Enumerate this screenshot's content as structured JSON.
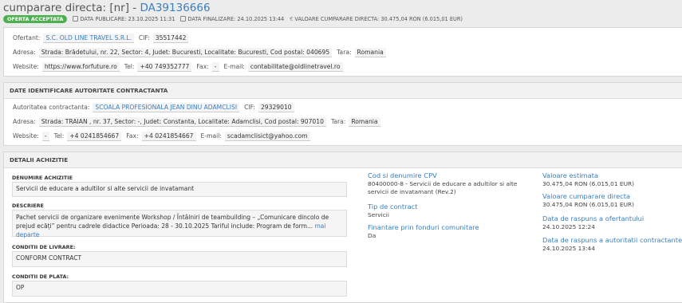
{
  "header": {
    "title_prefix": "cumparare directa: [nr] - ",
    "code": "DA39136666",
    "status": "OFERTA ACCEPTATA",
    "publish": "DATA PUBLICARE: 23.10.2025 11:31",
    "finalize": "DATA FINALIZARE: 24.10.2025 13:44",
    "value": "VALOARE CUMPARARE DIRECTA: 30.475,04   RON (6.015,01  EUR)"
  },
  "offerer": {
    "ofertant_label": "Ofertant:",
    "ofertant": "S.C. OLD LINE TRAVEL S.R.L.",
    "cif_label": "CIF:",
    "cif": "35517442",
    "adresa_label": "Adresa:",
    "adresa": "Strada: Brădetului, nr. 22, Sector: 4, Judet: Bucuresti, Localitate: Bucuresti, Cod postal: 040695",
    "tara_label": "Tara:",
    "tara": "Romania",
    "website_label": "Website:",
    "website": "https://www.forfuture.ro",
    "tel_label": "Tel:",
    "tel": "+40 749352777",
    "fax_label": "Fax:",
    "fax": "-",
    "email_label": "E-mail:",
    "email": "contabilitate@oldlinetravel.ro"
  },
  "authority": {
    "section_title": "DATE IDENTIFICARE AUTORITATE CONTRACTANTA",
    "name_label": "Autoritatea contractanta:",
    "name": "SCOALA PROFESIONALA JEAN DINU ADAMCLISI",
    "cif_label": "CIF:",
    "cif": "29329010",
    "adresa_label": "Adresa:",
    "adresa": "Strada: TRAIAN , nr. 37, Sector: -, Judet: Constanta, Localitate: Adamclisi, Cod postal: 907010",
    "tara_label": "Tara:",
    "tara": "Romania",
    "website_label": "Website:",
    "website": "-",
    "tel_label": "Tel:",
    "tel": "+4 0241854667",
    "fax_label": "Fax:",
    "fax": "+4 0241854667",
    "email_label": "E-mail:",
    "email": "scadamclisict@yahoo.com"
  },
  "details": {
    "section_title": "DETALII ACHIZITIE",
    "denumire_label": "DENUMIRE ACHIZITIE",
    "denumire": "Servicii de educare a adultilor si alte servicii de invatamant",
    "descriere_label": "DESCRIERE",
    "descriere": "Pachet servicii de organizare evenimente Workshop / Întâlniri de teambuilding – „Comunicare dincolo de prejud ecăți” pentru cadrele didactice Perioada: 28 - 30.10.2025 Tariful include: Program de form...",
    "mai_departe": "mai departe",
    "livrare_label": "CONDITII DE LIVRARE:",
    "livrare": "CONFORM CONTRACT",
    "plata_label": "CONDITII DE PLATA:",
    "plata": "OP",
    "cpv_title": "Cod si denumire CPV",
    "cpv_value": "80400000-8 - Servicii de educare a adultilor si alte servicii de invatamant (Rev.2)",
    "tip_title": "Tip de contract",
    "tip_value": "Servicii",
    "fonduri_title": "Finantare prin fonduri comunitare",
    "fonduri_value": "Da",
    "estimata_title": "Valoare estimata",
    "estimata_value": "30.475,04  RON (6.015,01  EUR)",
    "cumparare_title": "Valoare cumparare directa",
    "cumparare_value": "30.475,04  RON (6.015,01  EUR)",
    "raspuns_ofertant_title": "Data de raspuns a ofertantului",
    "raspuns_ofertant_value": "24.10.2025 12:24",
    "raspuns_autoritate_title": "Data de raspuns a autoritatii contractante",
    "raspuns_autoritate_value": "24.10.2025 13:44"
  }
}
